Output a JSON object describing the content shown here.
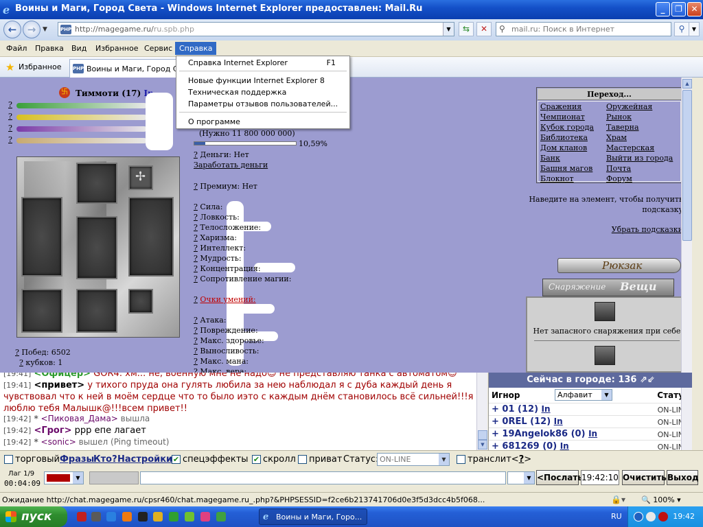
{
  "window": {
    "title": "Воины и Маги, Город Света - Windows Internet Explorer предоставлен: Mail.Ru",
    "minimize": "_",
    "maximize": "❐",
    "close": "✕"
  },
  "address": {
    "url_host": "http://magegame.ru/",
    "url_path": "ru.spb.php",
    "favicon": "PHP",
    "search_placeholder": "mail.ru: Поиск в Интернет"
  },
  "menu": {
    "items": [
      "Файл",
      "Правка",
      "Вид",
      "Избранное",
      "Сервис",
      "Справка"
    ],
    "help_dropdown": {
      "items": [
        {
          "label": "Справка Internet Explorer",
          "shortcut": "F1"
        },
        {
          "label": "Новые функции Internet Explorer 8",
          "shortcut": ""
        },
        {
          "label": "Техническая поддержка",
          "shortcut": ""
        },
        {
          "label": "Параметры отзывов пользователей...",
          "shortcut": ""
        },
        {
          "label": "О программе",
          "shortcut": ""
        }
      ]
    }
  },
  "favorites": {
    "label": "Избранное",
    "tab_title": "Воины и Маги, Город Света"
  },
  "game": {
    "player": {
      "name": "Тиммоти (17)",
      "status": "In"
    },
    "bar_marks": [
      "?",
      "?",
      "?",
      "?"
    ],
    "bar_colors": [
      "#3aa03a",
      "#d8c020",
      "#7a3aa8",
      "#c8aa70"
    ],
    "wins": {
      "q": "?",
      "label": "Побед: 6502"
    },
    "cups": {
      "q": "?",
      "label": "кубков: 1"
    },
    "xp": {
      "needed": "(Нужно 11 800 000 000)",
      "percent_label": "10,59%",
      "fraction": 0.1059
    },
    "money": "Деньги: Нет",
    "earn_money": "Заработать деньги",
    "premium": "Премиум: Нет",
    "stats": [
      "Сила:",
      "Ловкость:",
      "Телосложение:",
      "Харизма:",
      "Интеллект:",
      "Мудрость:",
      "Концентрация:",
      "Сопротивление магии:"
    ],
    "skill_points": "Очки умений:",
    "combat": [
      "Атака:",
      "Повреждение:",
      "Макс. здоровье:",
      "Выносливость:",
      "Макс. мана:",
      "Макс. вера:"
    ],
    "q": "?",
    "nav": {
      "title": "Переход...",
      "left": [
        "Сражения",
        "Чемпионат",
        "Кубок города",
        "Библиотека",
        "Дом кланов",
        "Банк",
        "Башня магов",
        "Блокнот"
      ],
      "right": [
        "Оружейная",
        "Рынок",
        "Таверна",
        "Храм",
        "Мастерская",
        "Выйти из города",
        "Почта",
        "Форум"
      ]
    },
    "hint": "Наведите на элемент, чтобы получить подсказку",
    "hint_remove": "Убрать подсказки",
    "backpack": {
      "title": "Рюкзак",
      "tab_equipment": "Снаряжение",
      "tab_things": "Вещи",
      "empty_text": "Нет запасного снаряжения при себе"
    }
  },
  "chat": {
    "lines": [
      {
        "time": "[19:41]",
        "nick": "<Офицер>",
        "nick_color": "green",
        "text": " GOR4: хм... не, военную мне не надо☺ не представляю танка с автоматом☺"
      },
      {
        "time": "[19:41]",
        "nick": "<привет>",
        "nick_color": "black",
        "text": " у тихого пруда она гулять любила за нею наблюдал я с дуба каждый день я"
      },
      {
        "time": "",
        "nick": "",
        "nick_color": "black",
        "text": "чувствовал что к ней в моём сердце что то было иэто с каждым днём становилось всё сильней!!!я"
      },
      {
        "time": "",
        "nick": "",
        "nick_color": "black",
        "text": "люблю тебя Малышк@!!!всем привет!!"
      }
    ],
    "sys1": {
      "time": "[19:42]",
      "star": "*",
      "nick": "<Пиковая_Дама>",
      "text": " вышла"
    },
    "line_grog": {
      "time": "[19:42]",
      "nick": "<Грог>",
      "text": " ppp епе лагает"
    },
    "sys2": {
      "time": "[19:42]",
      "star": "*",
      "nick": "<sonic>",
      "text": " вышел (Ping timeout)"
    }
  },
  "online": {
    "header": "Сейчас в городе: 136",
    "col_ignore": "Игнор",
    "col_sort": "Алфавит",
    "col_status": "Статус",
    "rows": [
      {
        "nick": "+ 01 (12)",
        "in": "In",
        "status": "ON-LINE"
      },
      {
        "nick": "+ 0REL (12)",
        "in": "In",
        "status": "ON-LINE"
      },
      {
        "nick": "+ 19Angelok86 (0)",
        "in": "In",
        "status": "ON-LINE"
      },
      {
        "nick": "+ 681269 (0)",
        "in": "In",
        "status": "ON-LINE"
      }
    ]
  },
  "options": {
    "trade": "торговый",
    "phrases": "Фразы",
    "who": "Кто?",
    "settings": "Настройки",
    "effects": "спецэффекты",
    "scroll": "скролл",
    "private": "приват",
    "status_label": "Статус:",
    "status_value": "ON-LINE",
    "translit": "транслит",
    "translit_help": "<?>",
    "help_q": "?"
  },
  "input": {
    "lag": "Лаг 1/9",
    "timer": "00:04:09",
    "color": "#b00000",
    "send": "<Послать",
    "clock": "19:42:10",
    "clear": "Очистить",
    "exit": "Выход"
  },
  "statusbar": {
    "text": "Ожидание http://chat.magegame.ru/cpsr460/chat.magegame.ru_.php?&PHPSESSID=f2ce6b213741706d0e3f5d3dcc4b5f068...",
    "zoom": "100%"
  },
  "taskbar": {
    "start": "пуск",
    "task_label": "Воины и Маги, Горо...",
    "lang": "RU",
    "time": "19:42"
  }
}
